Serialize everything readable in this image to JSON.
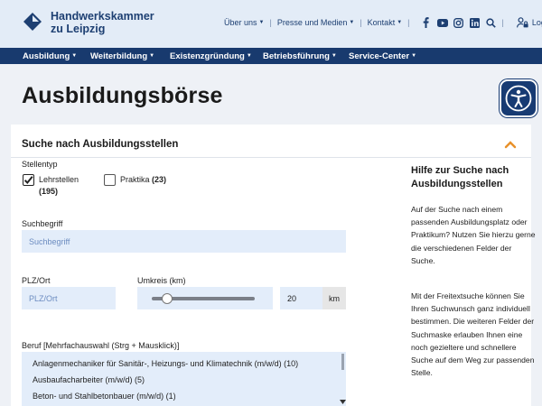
{
  "header": {
    "org_line1": "Handwerkskammer",
    "org_line2": "zu Leipzig",
    "util_links": [
      "Über uns",
      "Presse und Medien",
      "Kontakt"
    ],
    "social_icons": [
      "facebook-icon",
      "youtube-icon",
      "instagram-icon",
      "linkedin-icon"
    ],
    "login_label": "Login"
  },
  "mainnav": [
    "Ausbildung",
    "Weiterbildung",
    "Existenzgründung",
    "Betriebsführung",
    "Service-Center"
  ],
  "page": {
    "title": "Ausbildungsbörse"
  },
  "search": {
    "section_title": "Suche nach Ausbildungsstellen",
    "stellentyp_label": "Stellentyp",
    "lehrstellen_label": "Lehrstellen",
    "lehrstellen_count": "(195)",
    "lehrstellen_checked": true,
    "praktika_label": "Praktika",
    "praktika_count": "(23)",
    "praktika_checked": false,
    "suchbegriff_label": "Suchbegriff",
    "suchbegriff_placeholder": "Suchbegriff",
    "plz_label": "PLZ/Ort",
    "plz_placeholder": "PLZ/Ort",
    "umkreis_label": "Umkreis (km)",
    "umkreis_value": "20",
    "umkreis_unit": "km",
    "umkreis_slider_fraction": 0.15,
    "beruf_label": "Beruf [Mehrfachauswahl (Strg + Mausklick)]",
    "beruf_options": [
      "Anlagenmechaniker für Sanitär-, Heizungs- und Klimatechnik (m/w/d) (10)",
      "Ausbaufacharbeiter (m/w/d) (5)",
      "Beton- und Stahlbetonbauer (m/w/d) (1)"
    ]
  },
  "help": {
    "title": "Hilfe zur Suche nach Ausbildungsstellen",
    "para1": "Auf der Suche nach einem passenden Ausbildungsplatz oder Praktikum? Nutzen Sie hierzu gerne die verschiedenen Felder der Suche.",
    "para2": "Mit der Freitextsuche können Sie Ihren Suchwunsch ganz individuell bestimmen. Die weiteren Felder der Suchmaske erlauben Ihnen eine noch gezieltere und schnellere Suche auf dem Weg zur passenden Stelle."
  },
  "colors": {
    "brand_navy": "#183a6e",
    "accent_orange": "#e8912a",
    "field_bg": "#e3edfa"
  }
}
